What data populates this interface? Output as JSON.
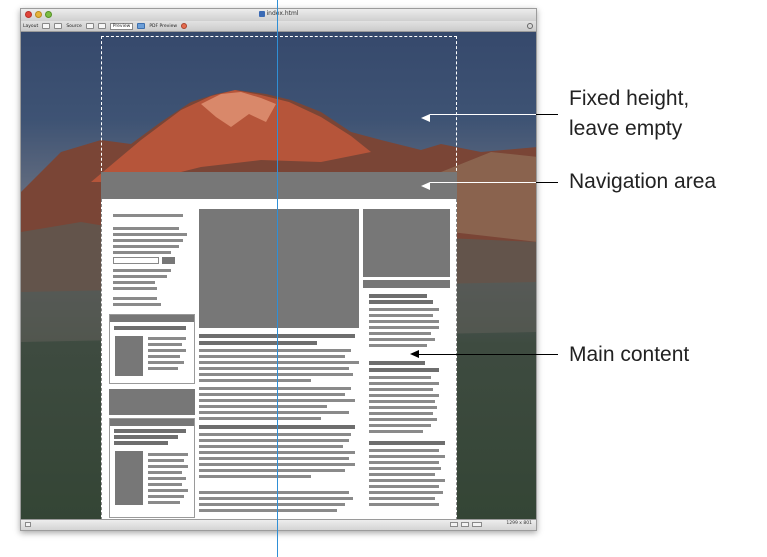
{
  "window": {
    "title": "index.html"
  },
  "toolbar": {
    "items": [
      "Layout",
      "Source",
      "Preview",
      "PDF Preview"
    ]
  },
  "statusbar": {
    "zoom": "1299 x 801"
  },
  "annotations": {
    "header_line1": "Fixed height,",
    "header_line2": "leave empty",
    "navigation": "Navigation area",
    "main": "Main content"
  },
  "colors": {
    "guide": "#2f8fd6",
    "placeholder": "#777777"
  }
}
